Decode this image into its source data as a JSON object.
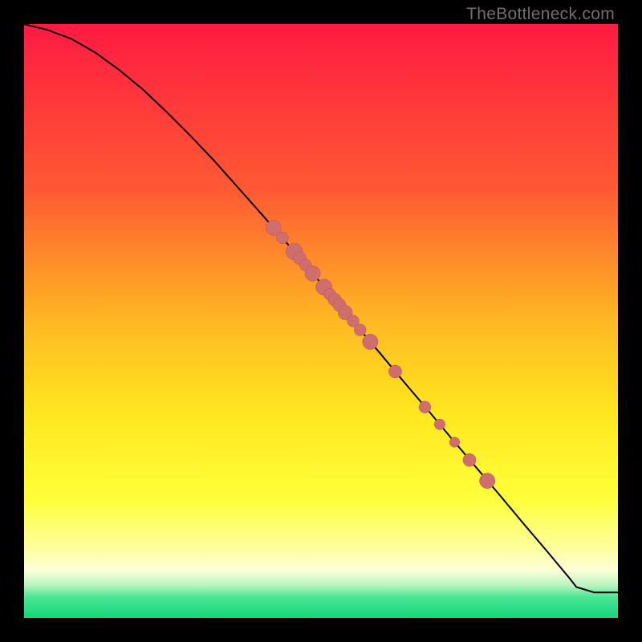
{
  "watermark": "TheBottleneck.com",
  "colors": {
    "black": "#000000",
    "line": "#000000",
    "dot_fill": "#cf6e6e",
    "dot_stroke": "#b94f4f",
    "gradient_stops": [
      {
        "offset": 0.0,
        "color": "#ff1a42"
      },
      {
        "offset": 0.28,
        "color": "#ff5a33"
      },
      {
        "offset": 0.5,
        "color": "#ffb822"
      },
      {
        "offset": 0.66,
        "color": "#ffe81f"
      },
      {
        "offset": 0.8,
        "color": "#ffff3a"
      },
      {
        "offset": 0.88,
        "color": "#feff9a"
      },
      {
        "offset": 0.92,
        "color": "#fdfed8"
      },
      {
        "offset": 0.945,
        "color": "#b9f5c1"
      },
      {
        "offset": 0.965,
        "color": "#4be694"
      },
      {
        "offset": 1.0,
        "color": "#11d879"
      }
    ]
  },
  "chart_data": {
    "type": "line",
    "title": "",
    "xlabel": "",
    "ylabel": "",
    "xlim": [
      0,
      100
    ],
    "ylim": [
      0,
      100
    ],
    "grid": false,
    "legend": false,
    "series": [
      {
        "name": "curve",
        "kind": "line",
        "x": [
          0,
          4,
          8,
          12,
          16,
          20,
          24,
          28,
          32,
          36,
          40,
          44,
          48,
          52,
          56,
          60,
          64,
          68,
          72,
          76,
          80,
          84,
          88,
          92,
          93,
          96,
          100
        ],
        "y": [
          100,
          99,
          97.5,
          95.2,
          92.3,
          89,
          85.2,
          81.2,
          77,
          72.5,
          68,
          63.4,
          58.7,
          54,
          49.2,
          44.5,
          39.7,
          35,
          30.2,
          25.5,
          20.8,
          16,
          11.3,
          6.5,
          5.2,
          4.3,
          4.3
        ]
      },
      {
        "name": "points",
        "kind": "scatter",
        "points": [
          {
            "x": 42.0,
            "y": 65.7,
            "r": 1.3
          },
          {
            "x": 43.5,
            "y": 64.0,
            "r": 1.0
          },
          {
            "x": 45.5,
            "y": 61.7,
            "r": 1.4
          },
          {
            "x": 46.4,
            "y": 60.6,
            "r": 1.1
          },
          {
            "x": 47.4,
            "y": 59.4,
            "r": 1.0
          },
          {
            "x": 48.6,
            "y": 58.0,
            "r": 1.3
          },
          {
            "x": 50.5,
            "y": 55.7,
            "r": 1.35
          },
          {
            "x": 51.5,
            "y": 54.5,
            "r": 1.0
          },
          {
            "x": 52.3,
            "y": 53.6,
            "r": 1.1
          },
          {
            "x": 53.1,
            "y": 52.7,
            "r": 1.1
          },
          {
            "x": 54.1,
            "y": 51.4,
            "r": 1.2
          },
          {
            "x": 55.4,
            "y": 50.0,
            "r": 1.0
          },
          {
            "x": 56.6,
            "y": 48.5,
            "r": 1.0
          },
          {
            "x": 58.3,
            "y": 46.5,
            "r": 1.3
          },
          {
            "x": 62.5,
            "y": 41.5,
            "r": 1.1
          },
          {
            "x": 67.5,
            "y": 35.5,
            "r": 1.0
          },
          {
            "x": 70.0,
            "y": 32.6,
            "r": 0.9
          },
          {
            "x": 72.5,
            "y": 29.6,
            "r": 0.85
          },
          {
            "x": 75.0,
            "y": 26.6,
            "r": 1.1
          },
          {
            "x": 78.0,
            "y": 23.1,
            "r": 1.3
          }
        ]
      }
    ]
  }
}
